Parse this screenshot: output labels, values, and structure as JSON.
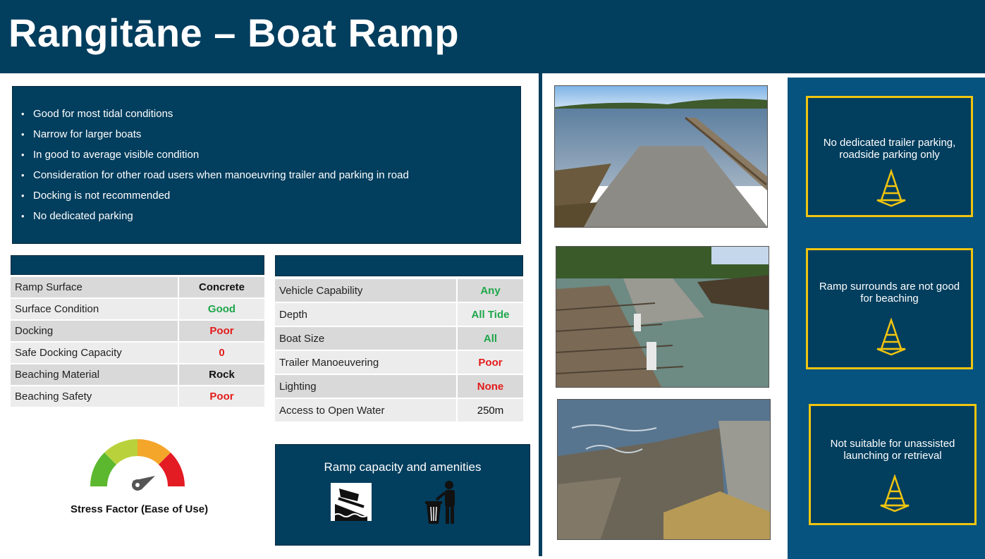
{
  "header": {
    "title": "Rangitāne – Boat Ramp"
  },
  "notes": [
    "Good for most tidal conditions",
    "Narrow for larger boats",
    "In good to average visible condition",
    "Consideration for other road users when manoeuvring  trailer and parking in road",
    "Docking is not recommended",
    "No dedicated parking"
  ],
  "ramp_table": {
    "rows": [
      {
        "label": "Ramp Surface",
        "value": "Concrete",
        "color": "#111111"
      },
      {
        "label": "Surface Condition",
        "value": "Good",
        "color": "#1fa64a"
      },
      {
        "label": "Docking",
        "value": "Poor",
        "color": "#e31b1b"
      },
      {
        "label": "Safe Docking Capacity",
        "value": "0",
        "color": "#e31b1b"
      },
      {
        "label": "Beaching Material",
        "value": "Rock",
        "color": "#111111"
      },
      {
        "label": "Beaching Safety",
        "value": "Poor",
        "color": "#e31b1b"
      }
    ]
  },
  "vehicle_table": {
    "rows": [
      {
        "label": "Vehicle Capability",
        "value": "Any",
        "color": "#1fa64a"
      },
      {
        "label": "Depth",
        "value": "All Tide",
        "color": "#1fa64a"
      },
      {
        "label": "Boat Size",
        "value": "All",
        "color": "#1fa64a"
      },
      {
        "label": "Trailer Manoeuvering",
        "value": "Poor",
        "color": "#e31b1b"
      },
      {
        "label": "Lighting",
        "value": "None",
        "color": "#e31b1b"
      },
      {
        "label": "Access to Open Water",
        "value": "250m",
        "color": "#111111"
      }
    ]
  },
  "gauge": {
    "label": "Stress Factor (Ease of Use)",
    "icon": "speedometer-icon"
  },
  "amenities": {
    "title": "Ramp capacity and amenities",
    "icons": [
      "boat-ramp-icon",
      "rubbish-bin-icon"
    ]
  },
  "warnings": [
    {
      "text": "No dedicated trailer parking, roadside parking only",
      "icon": "traffic-cone-icon"
    },
    {
      "text": "Ramp surrounds are not good for beaching",
      "icon": "traffic-cone-icon"
    },
    {
      "text": "Not suitable for unassisted launching or retrieval",
      "icon": "traffic-cone-icon"
    }
  ],
  "colors": {
    "navy": "#023e5e",
    "side_blue": "#05537e",
    "good": "#1fa64a",
    "poor": "#e31b1b",
    "warn_border": "#f1c40f"
  }
}
